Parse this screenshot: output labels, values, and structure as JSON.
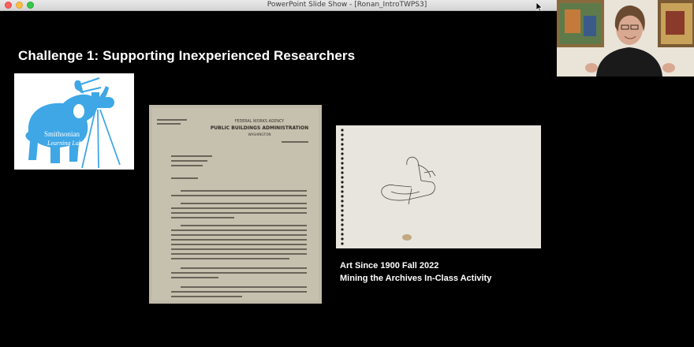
{
  "window": {
    "title": "PowerPoint Slide Show - [Ronan_IntroTWPS3]"
  },
  "slide": {
    "title": "Challenge 1: Supporting Inexperienced Researchers",
    "logo": {
      "text_line1": "Smithsonian",
      "text_line2": "Learning Lab"
    },
    "letter": {
      "header_agency": "FEDERAL WORKS AGENCY",
      "header_org": "PUBLIC BUILDINGS ADMINISTRATION",
      "header_city": "WASHINGTON"
    },
    "caption": {
      "line1": "Art Since 1900 Fall 2022",
      "line2": "Mining the Archives In-Class Activity"
    }
  },
  "colors": {
    "logo_blue": "#3fa7e6",
    "background": "#000000",
    "paper": "#bdb7a6"
  }
}
